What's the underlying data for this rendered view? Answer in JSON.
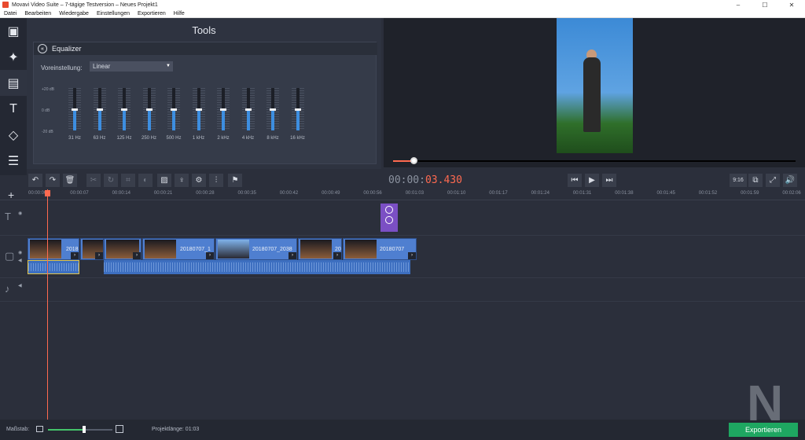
{
  "window": {
    "title": "Movavi Video Suite – 7-tägige Testversion – Neues Projekt1",
    "controls": [
      "–",
      "☐",
      "✕"
    ]
  },
  "menu": [
    "Datei",
    "Bearbeiten",
    "Wiedergabe",
    "Einstellungen",
    "Exportieren",
    "Hilfe"
  ],
  "left_tools": [
    "film-icon",
    "magic-wand-icon",
    "filmstrip-icon",
    "text-icon",
    "shapes-icon",
    "list-icon"
  ],
  "tools": {
    "heading": "Tools",
    "equalizer": {
      "title": "Equalizer",
      "preset_label": "Voreinstellung:",
      "preset_value": "Linear",
      "db_labels": [
        "+20 dB",
        "0 dB",
        "-20 dB"
      ],
      "bands": [
        {
          "label": "31 Hz",
          "value": 0
        },
        {
          "label": "63 Hz",
          "value": 0
        },
        {
          "label": "125 Hz",
          "value": 0
        },
        {
          "label": "250 Hz",
          "value": 0
        },
        {
          "label": "500 Hz",
          "value": 0
        },
        {
          "label": "1 kHz",
          "value": 0
        },
        {
          "label": "2 kHz",
          "value": 0
        },
        {
          "label": "4 kHz",
          "value": 0
        },
        {
          "label": "8 kHz",
          "value": 0
        },
        {
          "label": "16 kHz",
          "value": 0
        }
      ]
    }
  },
  "player": {
    "timecode_prefix": "00:00:",
    "timecode_value": "03.430",
    "aspect": "9:16",
    "progress": 0.05
  },
  "ruler_ticks": [
    "00:00:00",
    "00:00:07",
    "00:00:14",
    "00:00:21",
    "00:00:28",
    "00:00:35",
    "00:00:42",
    "00:00:49",
    "00:00:56",
    "00:01:03",
    "00:01:10",
    "00:01:17",
    "00:01:24",
    "00:01:31",
    "00:01:38",
    "00:01:45",
    "00:01:52",
    "00:01:59",
    "00:02:06"
  ],
  "clips": [
    {
      "name": "2018"
    },
    {
      "name": ""
    },
    {
      "name": ""
    },
    {
      "name": "20180707_1"
    },
    {
      "name": "20180707_2038"
    },
    {
      "name": "20"
    },
    {
      "name": "20180707"
    }
  ],
  "bottom": {
    "scale_label": "Maßstab:",
    "zoom": 0.56,
    "project_length": "Projektlänge:  01:03",
    "export_label": "Exportieren"
  },
  "watermark": "N",
  "colors": {
    "accent": "#ff6a50",
    "eq_fill": "#3d8ee0",
    "export": "#1ea761",
    "title_clip": "#7b4fc4",
    "clip": "#4f7fd0"
  }
}
